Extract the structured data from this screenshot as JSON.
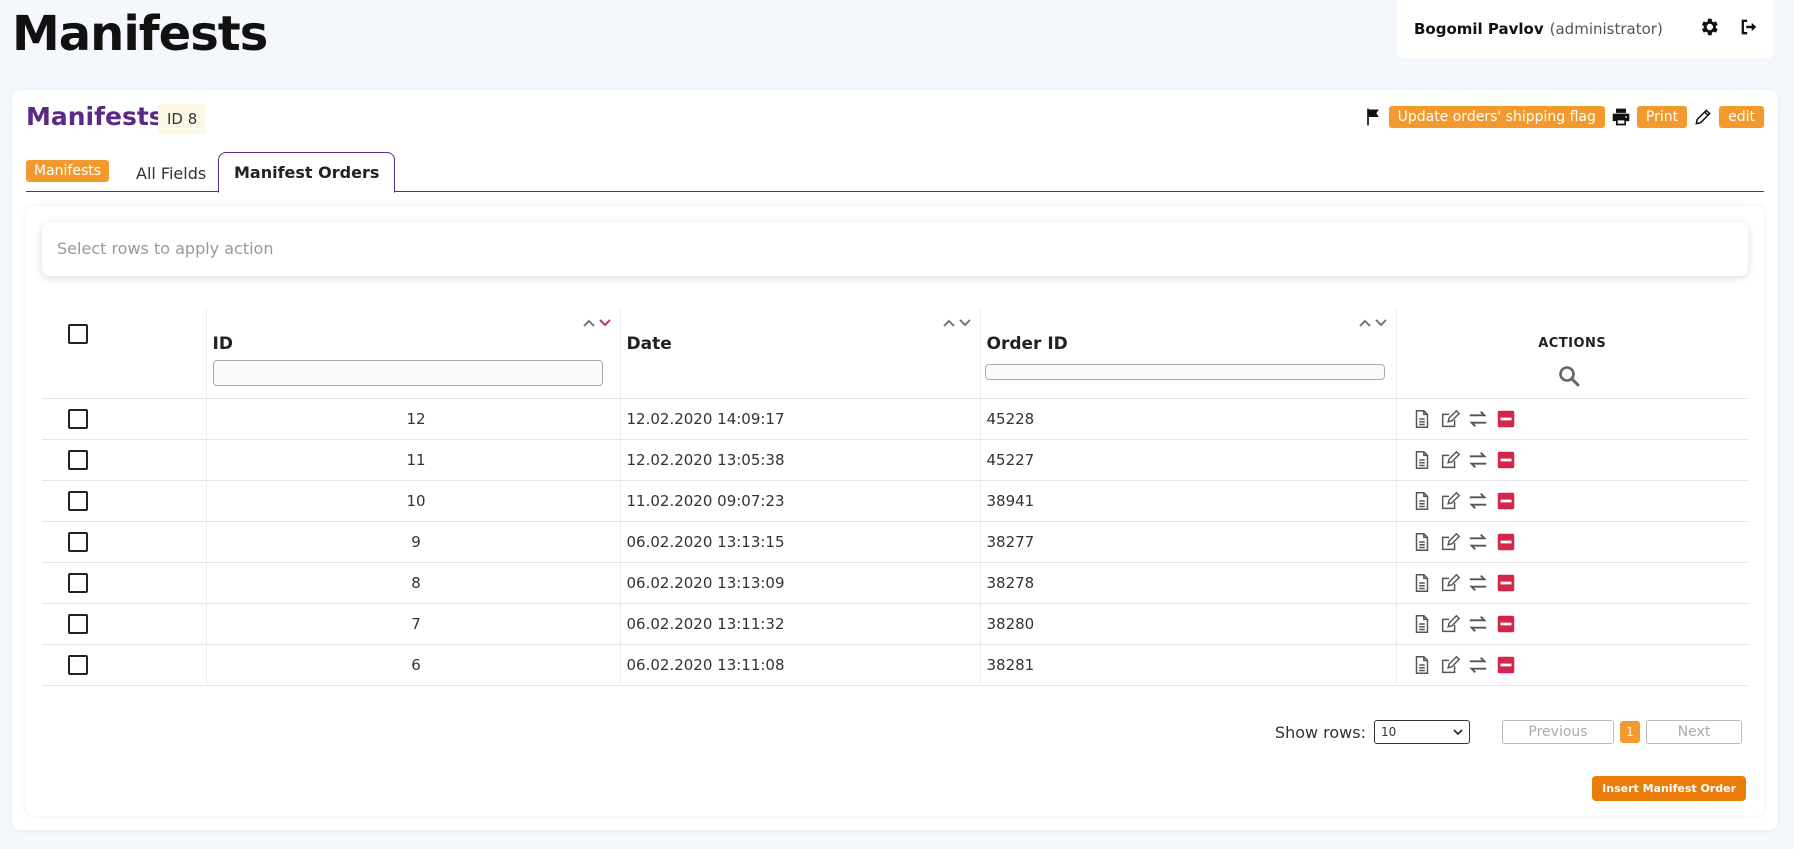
{
  "page_title": "Manifests",
  "user": {
    "name": "Bogomil Pavlov",
    "role": "(administrator)"
  },
  "card": {
    "title": "Manifests",
    "id_badge": "ID 8",
    "actions": {
      "update_flag": "Update orders' shipping flag",
      "print": "Print",
      "edit": "edit"
    }
  },
  "tabs": {
    "manifests": "Manifests",
    "all_fields": "All Fields",
    "manifest_orders": "Manifest Orders"
  },
  "action_bar": {
    "placeholder": "Select rows to apply action"
  },
  "table": {
    "headers": {
      "id": "ID",
      "date": "Date",
      "order_id": "Order ID",
      "actions": "ACTIONS"
    },
    "rows": [
      {
        "id": "12",
        "date": "12.02.2020 14:09:17",
        "order_id": "45228"
      },
      {
        "id": "11",
        "date": "12.02.2020 13:05:38",
        "order_id": "45227"
      },
      {
        "id": "10",
        "date": "11.02.2020 09:07:23",
        "order_id": "38941"
      },
      {
        "id": "9",
        "date": "06.02.2020 13:13:15",
        "order_id": "38277"
      },
      {
        "id": "8",
        "date": "06.02.2020 13:13:09",
        "order_id": "38278"
      },
      {
        "id": "7",
        "date": "06.02.2020 13:11:32",
        "order_id": "38280"
      },
      {
        "id": "6",
        "date": "06.02.2020 13:11:08",
        "order_id": "38281"
      }
    ]
  },
  "pagination": {
    "show_rows_label": "Show rows:",
    "rows_value": "10",
    "previous": "Previous",
    "page": "1",
    "next": "Next"
  },
  "insert_button": "Insert Manifest Order",
  "colors": {
    "accent_orange": "#f29a2e",
    "brand_purple": "#5b2a86",
    "delete_red": "#d4254b",
    "sort_active": "#c0395a"
  },
  "icons": [
    "gear-icon",
    "logout-icon",
    "flag-icon",
    "printer-icon",
    "pencil-icon",
    "search-icon",
    "document-icon",
    "edit-icon",
    "swap-icon",
    "delete-icon",
    "sort-up-icon",
    "sort-down-icon"
  ]
}
